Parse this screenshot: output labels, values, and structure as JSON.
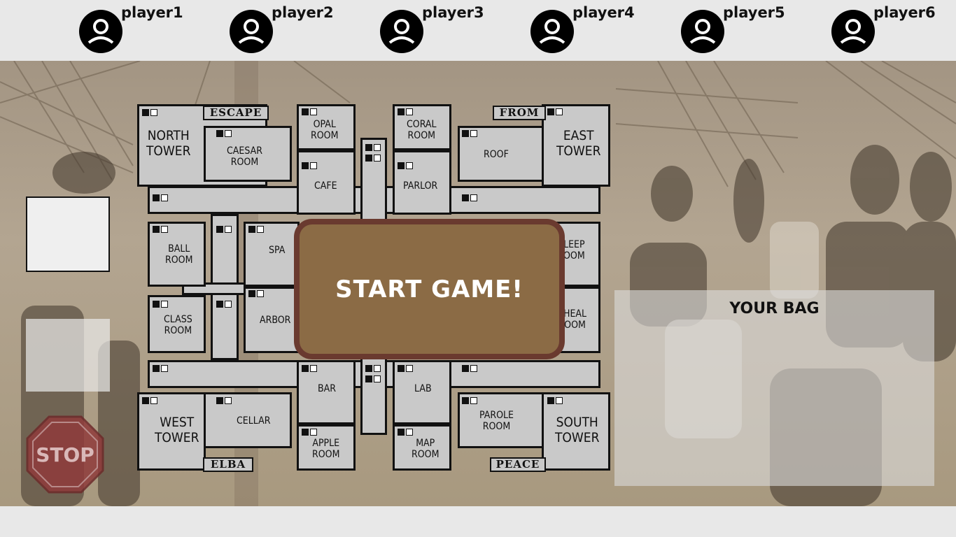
{
  "players": [
    {
      "name": "player1"
    },
    {
      "name": "player2"
    },
    {
      "name": "player3"
    },
    {
      "name": "player4"
    },
    {
      "name": "player5"
    },
    {
      "name": "player6"
    }
  ],
  "board": {
    "rooms": {
      "north_tower": "NORTH\nTOWER",
      "caesar_room": "CAESAR\nROOM",
      "opal_room": "OPAL\nROOM",
      "cafe": "CAFE",
      "coral_room": "CORAL\nROOM",
      "parlor": "PARLOR",
      "roof": "ROOF",
      "east_tower": "EAST\nTOWER",
      "ball_room": "BALL\nROOM",
      "spa": "SPA",
      "class_room": "CLASS\nROOM",
      "arbor": "ARBOR",
      "sleep_room": "LEEP\nOOM",
      "heal_room": "HEAL\nOOM",
      "west_tower": "WEST\nTOWER",
      "cellar": "CELLAR",
      "bar": "BAR",
      "apple_room": "APPLE\nROOM",
      "lab": "LAB",
      "map_room": "MAP\nROOM",
      "parole_room": "PAROLE\nROOM",
      "south_tower": "SOUTH\nTOWER"
    },
    "banners": {
      "escape": "ESCAPE",
      "from": "FROM",
      "elba": "ELBA",
      "peace": "PEACE"
    }
  },
  "start_button": "START GAME!",
  "stop_sign": "STOP",
  "bag": {
    "title": "YOUR BAG"
  },
  "colors": {
    "start_fill": "#8b6b45",
    "start_border": "#6a3a2f",
    "room_fill": "#c9c9c9",
    "stop_red": "#8f3b3b"
  }
}
